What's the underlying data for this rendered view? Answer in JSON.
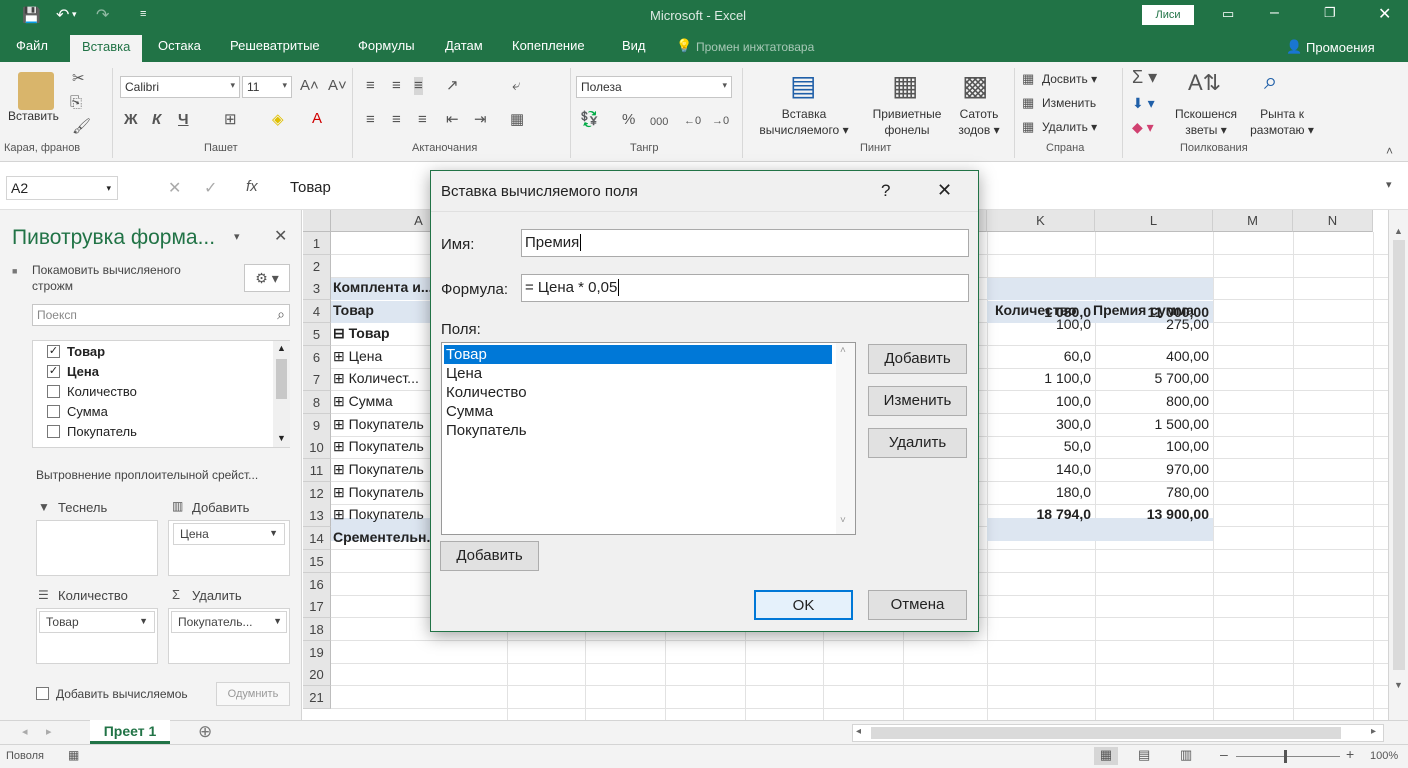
{
  "window": {
    "title": "Microsoft - Excel",
    "account": "Лиси",
    "share": "Промоения",
    "tell": "Промен инжтатовара"
  },
  "tabs": [
    "Файл",
    "Вставка",
    "Остака",
    "Решеватритые",
    "Формулы",
    "Датам",
    "Копепление",
    "Вид"
  ],
  "ribbon": {
    "paste": "Вставить",
    "font_name": "Calibri",
    "font_size": "11",
    "number_format": "Полеза",
    "insert_calc": [
      "Вставка",
      "вычисляемого"
    ],
    "pivot_fields": [
      "Привиетные",
      "фонелы"
    ],
    "slicer": [
      "Сатоть",
      "зодов"
    ],
    "add": "Досвить",
    "change": "Изменить",
    "delete": "Удалить",
    "sort": [
      "Пскошенся",
      "зветы"
    ],
    "find": [
      "Рынта к",
      "размотаю"
    ],
    "groups": [
      "Карая, франов",
      "Пашет",
      "Актаночания",
      "Тангр",
      "Пинит",
      "Спрана",
      "Поилкования"
    ]
  },
  "formula_bar": {
    "name_box": "A2",
    "content": "Товар"
  },
  "pane": {
    "title": "Пивотрувка форма...",
    "option": "Покамовить вычисляеного строжм",
    "search_placeholder": "Поексп",
    "fields": [
      {
        "label": "Товар",
        "checked": true
      },
      {
        "label": "Цена",
        "checked": true
      },
      {
        "label": "Количество",
        "checked": false
      },
      {
        "label": "Сумма",
        "checked": false
      },
      {
        "label": "Покупатель",
        "checked": false
      }
    ],
    "section": "Вытровнение проплоителыной срейст...",
    "zones": {
      "filters": "Теснель",
      "columns": "Добавить",
      "rows": "Количество",
      "values": "Удалить"
    },
    "zone_items": {
      "columns": "Цена",
      "rows": "Товар",
      "values": "Покупатель..."
    },
    "defer_label": "Добавить вычисляемоь",
    "update_btn": "Одумнить"
  },
  "grid": {
    "columns": [
      "A",
      "K",
      "L",
      "M",
      "N"
    ],
    "rows": [
      "1",
      "2",
      "3",
      "4",
      "5",
      "6",
      "7",
      "8",
      "9",
      "10",
      "11",
      "12",
      "13",
      "14",
      "15",
      "16",
      "17",
      "18",
      "19",
      "20",
      "21"
    ],
    "col_a": [
      "",
      "",
      "Комплента и...",
      "Товар",
      "⊟ Товар",
      "⊞ Цена",
      "⊞ Количест...",
      "⊞ Сумма",
      "⊞ Покупатель",
      "⊞ Покупатель",
      "⊞ Покупатель",
      "⊞ Покупатель",
      "⊞ Покупатель",
      "Срементельн..."
    ],
    "header_k": "Количество",
    "header_l": "Премия сумма",
    "col_k": [
      "1 080,0",
      "100,0",
      "60,0",
      "1 100,0",
      "100,0",
      "300,0",
      "50,0",
      "140,0",
      "180,0",
      "18 794,0"
    ],
    "col_l": [
      "11 000,00",
      "275,00",
      "400,00",
      "5 700,00",
      "800,00",
      "1 500,00",
      "100,00",
      "970,00",
      "780,00",
      "13 900,00"
    ]
  },
  "dialog": {
    "title": "Вставка вычисляемого поля",
    "help": "?",
    "close": "✕",
    "name_label": "Имя:",
    "name_value": "Премия",
    "formula_label": "Формула:",
    "formula_value": "= Цена * 0,05",
    "fields_label": "Поля:",
    "fields": [
      "Товар",
      "Цена",
      "Количество",
      "Сумма",
      "Покупатель"
    ],
    "add": "Добавить",
    "modify": "Изменить",
    "delete": "Удалить",
    "insert_field": "Добавить",
    "ok": "OK",
    "cancel": "Отмена"
  },
  "sheet": {
    "tab": "Преет 1"
  },
  "status": {
    "ready": "Поволя",
    "zoom": "100%"
  },
  "colors": {
    "excel_green": "#217346",
    "selection": "#0078d7",
    "pivot_header": "#dde6f1"
  }
}
